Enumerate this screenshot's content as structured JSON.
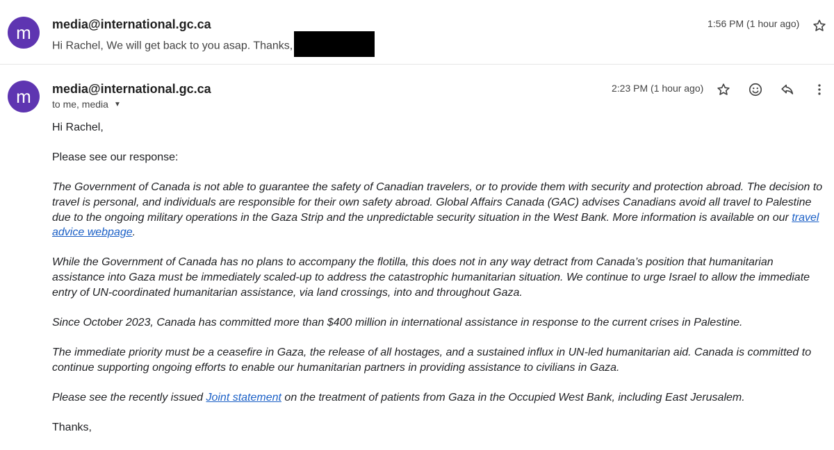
{
  "message1": {
    "avatar_letter": "m",
    "sender": "media@international.gc.ca",
    "snippet": "Hi Rachel, We will get back to you asap. Thanks,",
    "time": "1:56 PM (1 hour ago)",
    "star_icon": "star-outline-icon"
  },
  "message2": {
    "avatar_letter": "m",
    "sender": "media@international.gc.ca",
    "recipients": "to me, media",
    "time": "2:23 PM (1 hour ago)",
    "icons": [
      "star-outline-icon",
      "emoji-icon",
      "reply-icon",
      "more-vert-icon"
    ],
    "greeting": "Hi Rachel,",
    "intro": "Please see our response:",
    "p1_text": "The Government of Canada is not able to guarantee the safety of Canadian travelers, or to provide them with security and protection abroad. The decision to travel is personal, and individuals are responsible for their own safety abroad. Global Affairs Canada (GAC) advises Canadians avoid all travel to Palestine due to the ongoing military operations in the Gaza Strip and the unpredictable security situation in the West Bank. More information is available on our ",
    "p1_link": "travel advice webpage",
    "p1_end": ".",
    "p2": "While the Government of Canada has no plans to accompany the flotilla, this does not in any way detract from Canada’s position that humanitarian assistance into Gaza must be immediately scaled-up to address the catastrophic humanitarian situation. We continue to urge Israel to allow the immediate entry of UN-coordinated humanitarian assistance, via land crossings, into and throughout Gaza.",
    "p3": "Since October 2023, Canada has committed more than $400 million in international assistance in response to the current crises in Palestine.",
    "p4": "The immediate priority must be a ceasefire in Gaza, the release of all hostages, and a sustained influx in UN-led humanitarian aid. Canada is committed to continue supporting ongoing efforts to enable our humanitarian partners in providing assistance to civilians in Gaza.",
    "p5_text": "Please see the recently issued ",
    "p5_link": "Joint statement",
    "p5_end": " on the treatment of patients from Gaza in the Occupied West Bank, including East Jerusalem.",
    "signoff": "Thanks,"
  },
  "colors": {
    "avatar": "#5e35b1",
    "link": "#1a5fc6"
  }
}
